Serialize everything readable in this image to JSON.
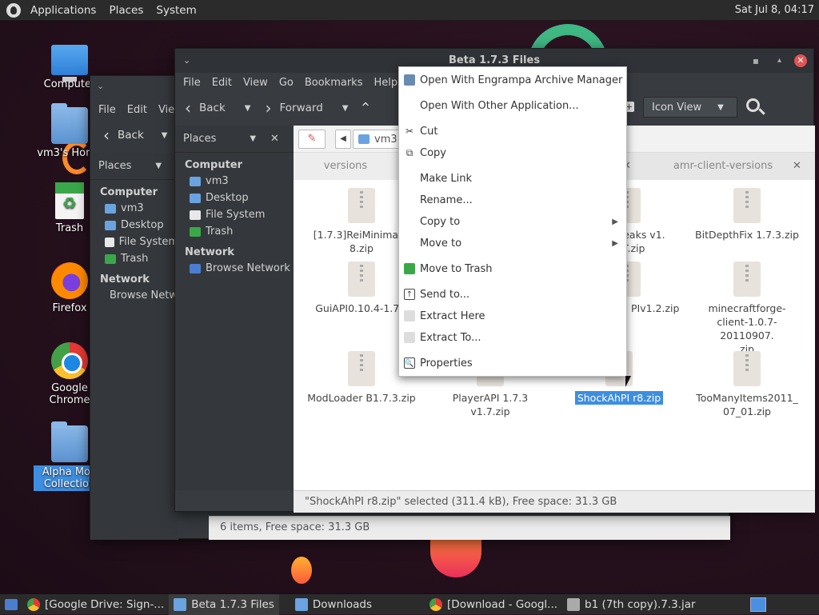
{
  "top_panel": {
    "menus": [
      "Applications",
      "Places",
      "System"
    ],
    "clock": "Sat Jul  8, 04:17"
  },
  "desktop_icons": [
    {
      "label": "Computer",
      "icon": "computer-icon"
    },
    {
      "label": "vm3's Home",
      "icon": "home-folder-icon"
    },
    {
      "label": "Trash",
      "icon": "trash-icon"
    },
    {
      "label": "Firefox",
      "icon": "firefox-icon"
    },
    {
      "label": "Google Chrome",
      "icon": "chrome-icon"
    },
    {
      "label": "Alpha Mod Collection",
      "icon": "folder-icon"
    }
  ],
  "back_window": {
    "menus": [
      "File",
      "Edit",
      "View"
    ],
    "back_label": "Back",
    "places_label": "Places",
    "sections": [
      {
        "title": "Computer",
        "items": [
          {
            "label": "vm3",
            "icon": "home-folder-icon"
          },
          {
            "label": "Desktop",
            "icon": "folder-icon"
          },
          {
            "label": "File System",
            "icon": "drive-icon"
          },
          {
            "label": "Trash",
            "icon": "trash-icon"
          }
        ]
      },
      {
        "title": "Network",
        "items": [
          {
            "label": "Browse Network",
            "icon": "network-icon"
          }
        ]
      }
    ],
    "status": "6 items, Free space: 31.3 GB"
  },
  "main_window": {
    "title": "Beta 1.7.3 Files",
    "menus": [
      "File",
      "Edit",
      "View",
      "Go",
      "Bookmarks",
      "Help"
    ],
    "back_label": "Back",
    "forward_label": "Forward",
    "view_mode": "Icon View",
    "places_label": "Places",
    "sections": [
      {
        "title": "Computer",
        "items": [
          {
            "label": "vm3",
            "icon": "home-folder-icon"
          },
          {
            "label": "Desktop",
            "icon": "folder-icon"
          },
          {
            "label": "File System",
            "icon": "drive-icon"
          },
          {
            "label": "Trash",
            "icon": "trash-icon"
          }
        ]
      },
      {
        "title": "Network",
        "items": [
          {
            "label": "Browse Network",
            "icon": "network-icon"
          }
        ]
      }
    ],
    "path_crumb": "vm3",
    "tabs": [
      {
        "label": "versions"
      },
      {
        "label": "amr-client-versions"
      }
    ],
    "files": [
      {
        "name": "[1.7.3]ReiMinimap_v2.8.zip",
        "shown": "[1.7.3]ReiMinimap_\n8.zip"
      },
      {
        "name": "",
        "shown": ""
      },
      {
        "name": "Tweaks v1.NT.zip",
        "shown": "weaks v1.\nNT.zip"
      },
      {
        "name": "BitDepthFix 1.7.3.zip",
        "shown": "BitDepthFix 1.7.3.zip"
      },
      {
        "name": "GuiAPI0.10.4-1.7.zip",
        "shown": "GuiAPI0.10.4-1.7.z"
      },
      {
        "name": "",
        "shown": ""
      },
      {
        "name": "PIv1.2.zip",
        "shown": "PIv1.2.zip"
      },
      {
        "name": "minecraftforge-client-1.0.7-20110907.zip",
        "shown": "minecraftforge-\nclient-1.0.7-20110907.\nzip"
      },
      {
        "name": "ModLoader B1.7.3.zip",
        "shown": "ModLoader B1.7.3.zip"
      },
      {
        "name": "PlayerAPI 1.7.3 v1.7.zip",
        "shown": "PlayerAPI 1.7.3 v1.7.zip"
      },
      {
        "name": "ShockAhPI r8.zip",
        "shown": "ShockAhPI r8.zip"
      },
      {
        "name": "TooManyItems2011_07_01.zip",
        "shown": "TooManyItems2011_\n07_01.zip"
      }
    ],
    "status": "\"ShockAhPI r8.zip\" selected (311.4 kB), Free space: 31.3 GB"
  },
  "context_menu": {
    "items": [
      {
        "label": "Open With Engrampa Archive Manager",
        "icon": "archive-manager-icon"
      },
      {
        "label": "Open With Other Application...",
        "icon": ""
      },
      {
        "label": "Cut",
        "icon": "cut-icon"
      },
      {
        "label": "Copy",
        "icon": "copy-icon"
      },
      {
        "label": "Make Link",
        "icon": ""
      },
      {
        "label": "Rename...",
        "icon": ""
      },
      {
        "label": "Copy to",
        "icon": "",
        "submenu": true
      },
      {
        "label": "Move to",
        "icon": "",
        "submenu": true
      },
      {
        "label": "Move to Trash",
        "icon": "trash-icon"
      },
      {
        "label": "Send to...",
        "icon": "send-icon"
      },
      {
        "label": "Extract Here",
        "icon": "extract-icon"
      },
      {
        "label": "Extract To...",
        "icon": "extract-icon"
      },
      {
        "label": "Properties",
        "icon": "properties-icon"
      }
    ]
  },
  "taskbar": {
    "tasks": [
      {
        "label": "[Google Drive: Sign-...",
        "icon": "chrome-icon"
      },
      {
        "label": "Beta 1.7.3 Files",
        "icon": "folder-icon",
        "active": true
      },
      {
        "label": "Downloads",
        "icon": "folder-icon"
      },
      {
        "label": "[Download - Googl...",
        "icon": "chrome-icon"
      },
      {
        "label": "b1 (7th copy).7.3.jar",
        "icon": "archive-icon"
      }
    ]
  }
}
